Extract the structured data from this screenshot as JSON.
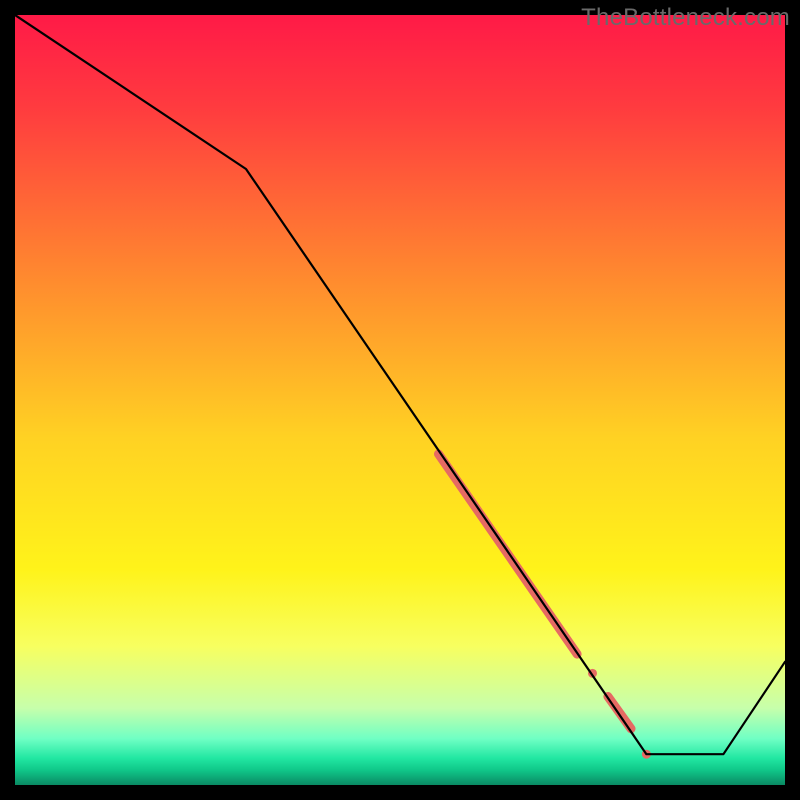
{
  "watermark": "TheBottleneck.com",
  "chart_data": {
    "type": "line",
    "title": "",
    "xlabel": "",
    "ylabel": "",
    "xlim": [
      0,
      100
    ],
    "ylim": [
      0,
      100
    ],
    "grid": false,
    "series": [
      {
        "name": "bottleneck-curve",
        "x": [
          0,
          30,
          82,
          92,
          100
        ],
        "y": [
          100,
          80,
          4,
          4,
          16
        ],
        "stroke": "#000000"
      }
    ],
    "highlights": [
      {
        "name": "highlight-segment-main",
        "x0": 55,
        "y0": 43,
        "x1": 73,
        "y1": 17,
        "color": "#e66a63",
        "thickness": 9
      },
      {
        "name": "highlight-dot-mid",
        "x": 75,
        "y": 14.5,
        "color": "#e66a63",
        "thickness": 9
      },
      {
        "name": "highlight-segment-lower",
        "x0": 77,
        "y0": 11.5,
        "x1": 80,
        "y1": 7.3,
        "color": "#e66a63",
        "thickness": 9
      },
      {
        "name": "highlight-dot-end",
        "x": 82,
        "y": 4,
        "color": "#e66a63",
        "thickness": 9
      }
    ],
    "background_gradient": {
      "stops": [
        {
          "offset": 0.0,
          "color": "#ff1a47"
        },
        {
          "offset": 0.12,
          "color": "#ff3b3f"
        },
        {
          "offset": 0.35,
          "color": "#ff8d2e"
        },
        {
          "offset": 0.55,
          "color": "#ffd223"
        },
        {
          "offset": 0.72,
          "color": "#fff31a"
        },
        {
          "offset": 0.82,
          "color": "#f7ff60"
        },
        {
          "offset": 0.9,
          "color": "#c7ffab"
        },
        {
          "offset": 0.94,
          "color": "#6fffc4"
        },
        {
          "offset": 0.965,
          "color": "#22e7a2"
        },
        {
          "offset": 0.98,
          "color": "#10c98a"
        },
        {
          "offset": 1.0,
          "color": "#0a8a63"
        }
      ]
    }
  }
}
